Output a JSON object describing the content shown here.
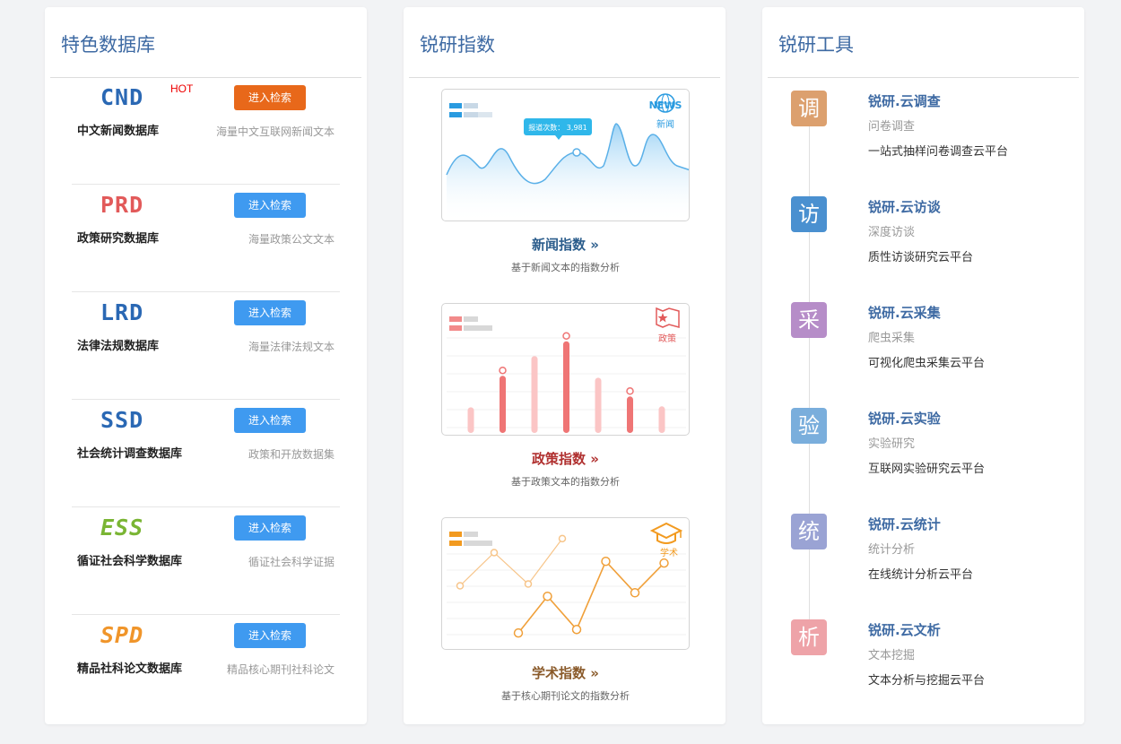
{
  "col1": {
    "title": "特色数据库",
    "items": [
      {
        "logo": "CND",
        "name": "中文新闻数据库",
        "button": "进入检索",
        "desc": "海量中文互联网新闻文本",
        "hot": "HOT",
        "logo_color": "#2a68b4"
      },
      {
        "logo": "PRD",
        "name": "政策研究数据库",
        "button": "进入检索",
        "desc": "海量政策公文文本",
        "logo_color": "#e25a5a"
      },
      {
        "logo": "LRD",
        "name": "法律法规数据库",
        "button": "进入检索",
        "desc": "海量法律法规文本",
        "logo_color": "#2a68b4"
      },
      {
        "logo": "SSD",
        "name": "社会统计调查数据库",
        "button": "进入检索",
        "desc": "政策和开放数据集",
        "logo_color": "#2a68b4"
      },
      {
        "logo": "ESS",
        "name": "循证社会科学数据库",
        "button": "进入检索",
        "desc": "循证社会科学证据",
        "logo_color": "#7ab534"
      },
      {
        "logo": "SPD",
        "name": "精品社科论文数据库",
        "button": "进入检索",
        "desc": "精品核心期刊社科论文",
        "logo_color": "#f0952a"
      }
    ]
  },
  "col2": {
    "title": "锐研指数",
    "items": [
      {
        "title": "新闻指数 »",
        "desc": "基于新闻文本的指数分析",
        "badge_en": "NEWS",
        "badge_cn": "新闻",
        "tooltip": "报道次数：  3,981",
        "title_color": "#2b5d8c"
      },
      {
        "title": "政策指数 »",
        "desc": "基于政策文本的指数分析",
        "badge_cn": "政策",
        "title_color": "#b0302f"
      },
      {
        "title": "学术指数 »",
        "desc": "基于核心期刊论文的指数分析",
        "badge_cn": "学术",
        "title_color": "#8a5a2a"
      }
    ],
    "policy_bars": [
      0.26,
      0.58,
      0.78,
      0.93,
      0.56,
      0.37,
      0.27
    ],
    "policy_markers": [
      false,
      true,
      false,
      true,
      false,
      true,
      false
    ],
    "academic_series_a": [
      3,
      24,
      5,
      44,
      26,
      43
    ],
    "academic_series_b": [
      30,
      49,
      31,
      57
    ]
  },
  "col3": {
    "title": "锐研工具",
    "items": [
      {
        "icon_char": "调",
        "name": "锐研.云调查",
        "sub": "问卷调查",
        "desc": "一站式抽样问卷调查云平台",
        "color": "#dca06e"
      },
      {
        "icon_char": "访",
        "name": "锐研.云访谈",
        "sub": "深度访谈",
        "desc": "质性访谈研究云平台",
        "color": "#4a90d0"
      },
      {
        "icon_char": "采",
        "name": "锐研.云采集",
        "sub": "爬虫采集",
        "desc": "可视化爬虫采集云平台",
        "color": "#b68dc8"
      },
      {
        "icon_char": "验",
        "name": "锐研.云实验",
        "sub": "实验研究",
        "desc": "互联网实验研究云平台",
        "color": "#7aaedc"
      },
      {
        "icon_char": "统",
        "name": "锐研.云统计",
        "sub": "统计分析",
        "desc": "在线统计分析云平台",
        "color": "#9aa3d4"
      },
      {
        "icon_char": "析",
        "name": "锐研.云文析",
        "sub": "文本挖掘",
        "desc": "文本分析与挖掘云平台",
        "color": "#eea3a8"
      }
    ]
  }
}
